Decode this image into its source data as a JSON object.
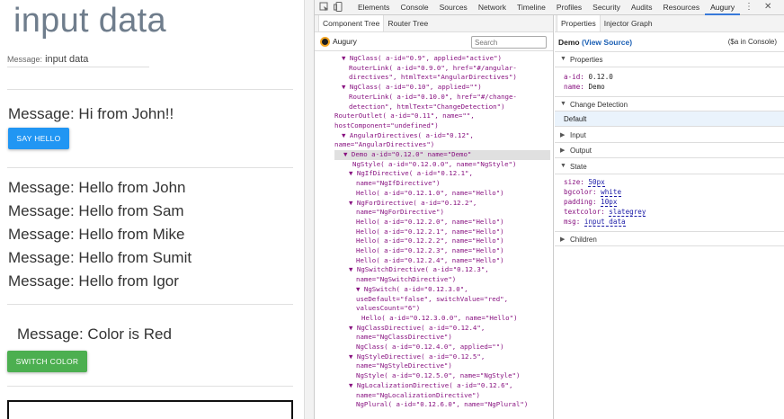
{
  "app": {
    "title": "input data",
    "message_label": "Message:",
    "message_value": "input data",
    "john_message": "Message: Hi from John!!",
    "say_hello_button": "SAY HELLO",
    "hello_messages": [
      "Message: Hello from John",
      "Message: Hello from Sam",
      "Message: Hello from Mike",
      "Message: Hello from Sumit",
      "Message: Hello from Igor"
    ],
    "color_message": "Message: Color is Red",
    "switch_color_button": "SWITCH COLOR"
  },
  "devtools": {
    "tabs": [
      "Elements",
      "Console",
      "Sources",
      "Network",
      "Timeline",
      "Profiles",
      "Security",
      "Audits",
      "Resources",
      "Augury"
    ],
    "active_tab": "Augury",
    "icons": [
      "inspect-icon",
      "device-icon",
      "more-icon",
      "close-icon"
    ],
    "left_subtabs": [
      "Component Tree",
      "Router Tree"
    ],
    "augury_label": "Augury",
    "search_placeholder": "Search",
    "right_subtabs": [
      "Properties",
      "Injector Graph"
    ],
    "component_name": "Demo",
    "view_source": "(View Source)",
    "in_console": "($a in Console)",
    "sections": {
      "properties": "Properties",
      "change_detection": "Change Detection",
      "change_detection_value": "Default",
      "input": "Input",
      "output": "Output",
      "state": "State",
      "children": "Children"
    },
    "properties": [
      {
        "k": "a-id:",
        "v": "0.12.0"
      },
      {
        "k": "name:",
        "v": "Demo"
      }
    ],
    "state": [
      {
        "k": "size:",
        "v": "50px"
      },
      {
        "k": "bgcolor:",
        "v": "white"
      },
      {
        "k": "padding:",
        "v": "10px"
      },
      {
        "k": "textcolor:",
        "v": "slategrey"
      },
      {
        "k": "msg:",
        "v": "input data"
      }
    ],
    "tree": [
      "▼ NgClass( a-id=\"0.9\", applied=\"active\")",
      "RouterLink( a-id=\"0.9.0\", href=\"#/angular-",
      "directives\", htmlText=\"AngularDirectives\")",
      "▼ NgClass( a-id=\"0.10\", applied=\"\")",
      "RouterLink( a-id=\"0.10.0\", href=\"#/change-",
      "detection\", htmlText=\"ChangeDetection\")",
      "RouterOutlet( a-id=\"0.11\", name=\"\",",
      "hostComponent=\"undefined\")",
      "▼ AngularDirectives( a-id=\"0.12\",",
      "name=\"AngularDirectives\")",
      "▼ Demo  a-id=\"0.12.0\"  name=\"Demo\"",
      "NgStyle( a-id=\"0.12.0.0\", name=\"NgStyle\")",
      "▼ NgIfDirective( a-id=\"0.12.1\",",
      "name=\"NgIfDirective\")",
      "Hello( a-id=\"0.12.1.0\", name=\"Hello\")",
      "▼ NgForDirective( a-id=\"0.12.2\",",
      "name=\"NgForDirective\")",
      "Hello( a-id=\"0.12.2.0\", name=\"Hello\")",
      "Hello( a-id=\"0.12.2.1\", name=\"Hello\")",
      "Hello( a-id=\"0.12.2.2\", name=\"Hello\")",
      "Hello( a-id=\"0.12.2.3\", name=\"Hello\")",
      "Hello( a-id=\"0.12.2.4\", name=\"Hello\")",
      "▼ NgSwitchDirective( a-id=\"0.12.3\",",
      "name=\"NgSwitchDirective\")",
      "▼ NgSwitch( a-id=\"0.12.3.0\",",
      "useDefault=\"false\", switchValue=\"red\",",
      "valuesCount=\"6\")",
      "Hello( a-id=\"0.12.3.0.0\", name=\"Hello\")",
      "▼ NgClassDirective( a-id=\"0.12.4\",",
      "name=\"NgClassDirective\")",
      "NgClass( a-id=\"0.12.4.0\", applied=\"\")",
      "▼ NgStyleDirective( a-id=\"0.12.5\",",
      "name=\"NgStyleDirective\")",
      "NgStyle( a-id=\"0.12.5.0\", name=\"NgStyle\")",
      "▼ NgLocalizationDirective( a-id=\"0.12.6\",",
      "name=\"NgLocalizationDirective\")",
      "NgPlural( a-id=\"0.12.6.0\", name=\"NgPlural\")"
    ]
  }
}
